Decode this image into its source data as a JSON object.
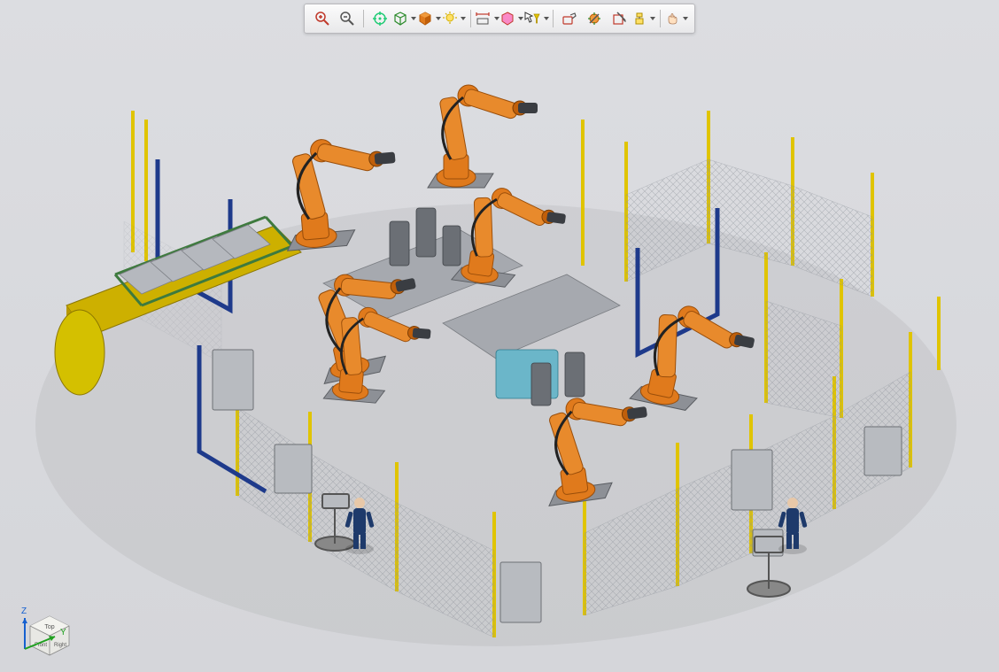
{
  "toolbar": {
    "zoom_in": {
      "name": "zoom-in-icon"
    },
    "zoom_out": {
      "name": "zoom-out-icon"
    },
    "fit_view": {
      "name": "fit-view-icon"
    },
    "view_cube": {
      "name": "view-mode-icon"
    },
    "render_style": {
      "name": "render-style-icon"
    },
    "lighting": {
      "name": "lighting-icon"
    },
    "measure": {
      "name": "measure-icon"
    },
    "box_select": {
      "name": "box-select-icon"
    },
    "pointer_filter": {
      "name": "pointer-filter-icon"
    },
    "sketch_tool": {
      "name": "sketch-tool-icon"
    },
    "dimension": {
      "name": "dimension-icon"
    },
    "section": {
      "name": "section-icon"
    },
    "explode": {
      "name": "explode-icon"
    },
    "grab": {
      "name": "grab-icon"
    }
  },
  "axis_triad": {
    "z_label": "Z",
    "y_label": "Y",
    "top_label": "Top",
    "front_label": "Front",
    "right_label": "Right"
  },
  "scene": {
    "description": "Isometric 3D factory robotic welding cell simulation",
    "robot_count": 7,
    "operator_count": 2,
    "colors": {
      "robot": "#e07a1c",
      "robot_dark": "#c05f0a",
      "fence_post": "#e0c400",
      "fence_mesh": "#9aa0a6",
      "floor": "#b8bbc0",
      "human": "#1e3a6b",
      "fixture": "#6b6f75",
      "conveyor_base": "#4a7a4a",
      "coil": "#d4c000"
    }
  }
}
